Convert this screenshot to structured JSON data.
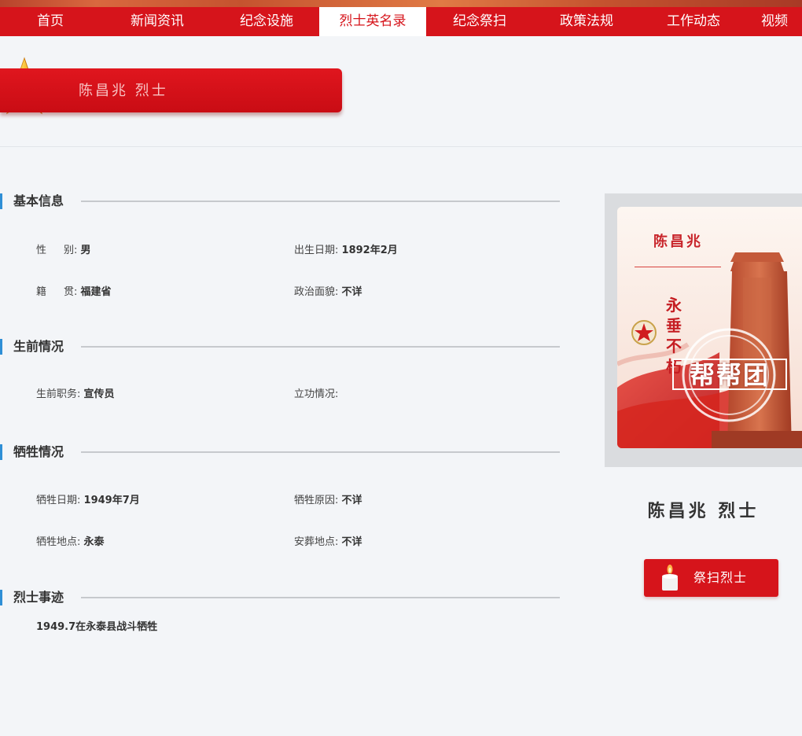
{
  "nav": {
    "items": [
      {
        "label": "首页",
        "width": 128
      },
      {
        "label": "新闻资讯",
        "width": 144
      },
      {
        "label": "纪念设施",
        "width": 134
      },
      {
        "label": "烈士英名录",
        "width": 136,
        "active": true
      },
      {
        "label": "纪念祭扫",
        "width": 136
      },
      {
        "label": "政策法规",
        "width": 136
      },
      {
        "label": "工作动态",
        "width": 136
      },
      {
        "label": "视频",
        "width": 70
      }
    ]
  },
  "banner": {
    "title": "陈昌兆 烈士"
  },
  "sections": {
    "basic": {
      "title": "基本信息"
    },
    "life": {
      "title": "生前情况"
    },
    "sacrifice": {
      "title": "牺牲情况"
    },
    "deeds": {
      "title": "烈士事迹"
    }
  },
  "fields": {
    "gender": {
      "label": "性别",
      "value": "男"
    },
    "birth": {
      "label": "出生日期",
      "value": "1892年2月"
    },
    "origin": {
      "label": "籍贯",
      "value": "福建省"
    },
    "political": {
      "label": "政治面貌",
      "value": "不详"
    },
    "position": {
      "label": "生前职务",
      "value": "宣传员"
    },
    "merit": {
      "label": "立功情况",
      "value": ""
    },
    "death_date": {
      "label": "牺牲日期",
      "value": "1949年7月"
    },
    "death_reason": {
      "label": "牺牲原因",
      "value": "不详"
    },
    "death_place": {
      "label": "牺牲地点",
      "value": "永泰"
    },
    "burial_place": {
      "label": "安葬地点",
      "value": "不详"
    }
  },
  "deeds_text": "1949.7在永泰县战斗牺牲",
  "photo": {
    "name": "陈昌兆",
    "slogan": "永垂不朽",
    "watermark": "帮帮团"
  },
  "hero_name": "陈昌兆 烈士",
  "tribute_button": {
    "label": "祭扫烈士"
  },
  "colors": {
    "primary_red": "#d6141b",
    "accent_blue": "#2f8fd6",
    "page_bg": "#f3f5f8"
  },
  "icons": {
    "banner": "gold-star-icon",
    "button": "candle-icon"
  }
}
